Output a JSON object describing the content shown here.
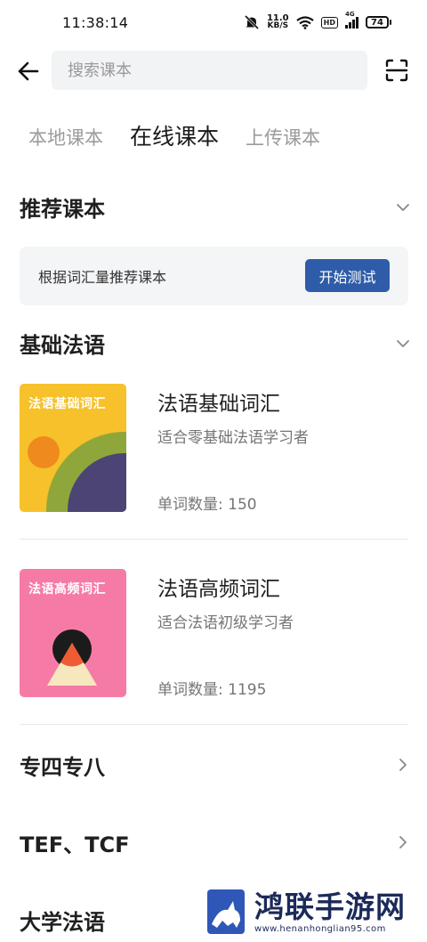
{
  "status_bar": {
    "time": "11:38:14",
    "net_speed_value": "11.0",
    "net_speed_unit": "KB/S",
    "hd_label": "HD",
    "signal_tag": "4G",
    "battery": "74"
  },
  "header": {
    "search_placeholder": "搜索课本"
  },
  "tabs": [
    {
      "label": "本地课本",
      "active": false
    },
    {
      "label": "在线课本",
      "active": true
    },
    {
      "label": "上传课本",
      "active": false
    }
  ],
  "recommend": {
    "title": "推荐课本",
    "card_text": "根据词汇量推荐课本",
    "button_label": "开始测试"
  },
  "basic": {
    "title": "基础法语",
    "books": [
      {
        "cover_title": "法语基础词汇",
        "name": "法语基础词汇",
        "desc": "适合零基础法语学习者",
        "count": "单词数量: 150",
        "cover_color": "#f6c12a"
      },
      {
        "cover_title": "法语高频词汇",
        "name": "法语高频词汇",
        "desc": "适合法语初级学习者",
        "count": "单词数量: 1195",
        "cover_color": "#f57ba6"
      }
    ]
  },
  "categories": [
    {
      "label": "专四专八"
    },
    {
      "label": "TEF、TCF"
    },
    {
      "label": "大学法语"
    }
  ],
  "watermark": {
    "title": "鸿联手游网",
    "url": "www.henanhonglian95.com"
  },
  "colors": {
    "accent": "#2e5ca8"
  }
}
